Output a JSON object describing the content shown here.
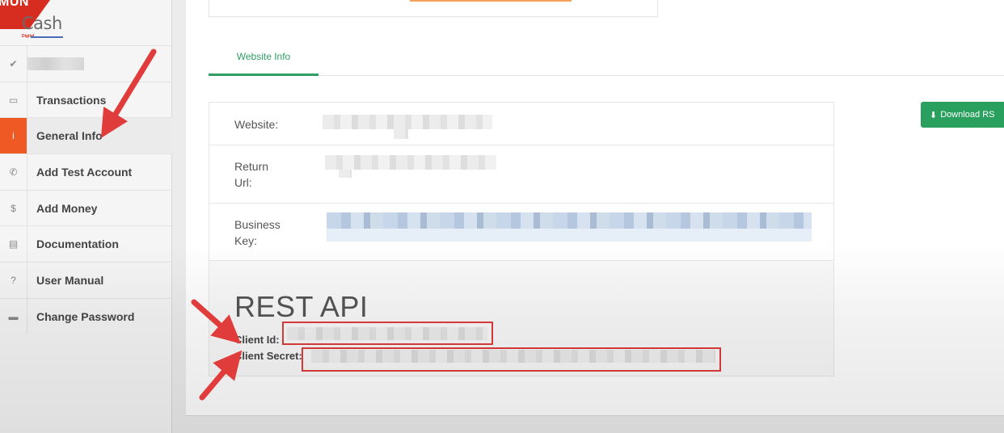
{
  "sidebar": {
    "logo": {
      "top_text": "MUN",
      "brand": "Cash",
      "sub": "Digital"
    },
    "items": [
      {
        "icon": "check-icon",
        "label": ""
      },
      {
        "icon": "money-icon",
        "label": "Transactions"
      },
      {
        "icon": "info-icon",
        "label": "General Info",
        "active": true
      },
      {
        "icon": "phone-icon",
        "label": "Add Test Account"
      },
      {
        "icon": "dollar-icon",
        "label": "Add Money"
      },
      {
        "icon": "book-icon",
        "label": "Documentation"
      },
      {
        "icon": "question-icon",
        "label": "User Manual"
      },
      {
        "icon": "briefcase-icon",
        "label": "Change Password"
      }
    ]
  },
  "tabs": [
    {
      "label": "Website Info",
      "active": true
    }
  ],
  "download_button": {
    "label": "Download RS"
  },
  "info": {
    "website_label": "Website:",
    "return_url_label_1": "Return",
    "return_url_label_2": "Url:",
    "business_key_label_1": "Business",
    "business_key_label_2": "Key:"
  },
  "rest_api": {
    "title": "REST API",
    "client_id_label": "Client Id:",
    "client_secret_label": "Client Secret:"
  },
  "colors": {
    "accent_green": "#2e9e63",
    "active_orange": "#ef5a24",
    "annotation_red": "#e03c3c"
  }
}
